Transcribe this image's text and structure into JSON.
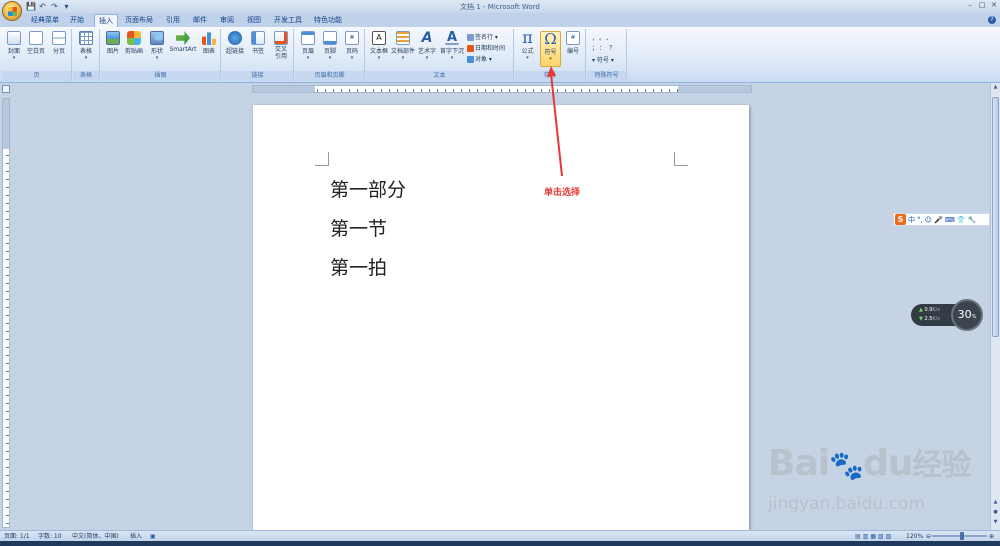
{
  "window": {
    "title": "文档 1 - Microsoft Word",
    "controls": [
      "–",
      "□",
      "✕"
    ]
  },
  "qat": {
    "save": "💾",
    "undo": "↶",
    "redo": "↷",
    "more": "▾"
  },
  "tabs": [
    "经典菜单",
    "开始",
    "插入",
    "页面布局",
    "引用",
    "邮件",
    "审阅",
    "视图",
    "开发工具",
    "特色功能"
  ],
  "active_tab": "插入",
  "ribbon": {
    "groups": {
      "page": {
        "label": "页",
        "buttons": [
          "封面",
          "空白页",
          "分页"
        ]
      },
      "table": {
        "label": "表格",
        "buttons": [
          "表格"
        ]
      },
      "illustration": {
        "label": "插图",
        "buttons": [
          "图片",
          "剪贴画",
          "形状",
          "SmartArt",
          "图表"
        ]
      },
      "links": {
        "label": "链接",
        "buttons": [
          "超链接",
          "书签",
          "交叉引用"
        ]
      },
      "header_footer": {
        "label": "页眉和页脚",
        "buttons": [
          "页眉",
          "页脚",
          "页码"
        ]
      },
      "text": {
        "label": "文本",
        "buttons": [
          "文本框",
          "文档部件",
          "艺术字",
          "首字下沉"
        ],
        "small": [
          "签名行",
          "日期和时间",
          "对象"
        ]
      },
      "symbols": {
        "label": "符号",
        "buttons": [
          "公式",
          "符号",
          "编号"
        ]
      },
      "special": {
        "label": "特殊符号",
        "items": [
          "，",
          "。",
          "、",
          "；",
          "：",
          "？"
        ],
        "dropdown": "符号"
      }
    }
  },
  "document": {
    "lines": [
      "第一部分",
      "第一节",
      "第一拍"
    ]
  },
  "annotation": {
    "text": "单击选择"
  },
  "ime": {
    "items": [
      "中",
      "°,",
      "☺",
      "🎤",
      "⌨",
      "👕",
      "🔧"
    ]
  },
  "net_widget": {
    "up": "0.9",
    "down": "2.5",
    "unit": "K/s",
    "percent": "30",
    "percent_unit": "%"
  },
  "status": {
    "page": "页面: 1/1",
    "words": "字数: 10",
    "lang": "中文(简体，中国)",
    "mode": "插入",
    "zoom": "120%"
  },
  "watermark": {
    "brand": "Bai",
    "brand2": "du",
    "brand3": "经验",
    "url": "jingyan.baidu.com"
  }
}
